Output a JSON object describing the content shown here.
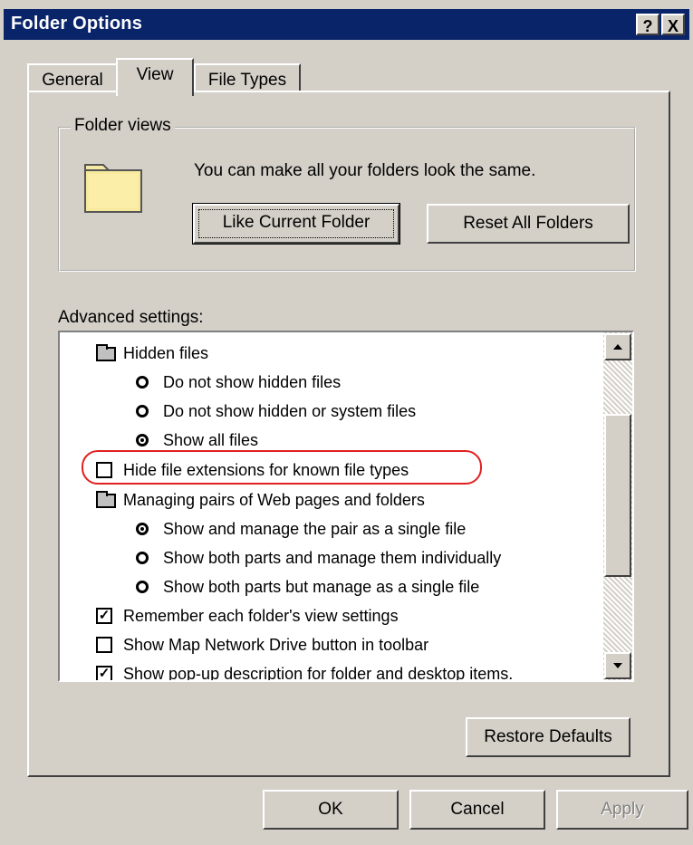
{
  "window": {
    "title": "Folder Options",
    "help_btn": "?",
    "close_btn": "X"
  },
  "tabs": [
    "General",
    "View",
    "File Types"
  ],
  "folder_views": {
    "legend": "Folder views",
    "text": "You can make all your folders look the same.",
    "like_current": "Like Current Folder",
    "reset_all": "Reset All Folders"
  },
  "advanced": {
    "label": "Advanced settings:",
    "items": [
      {
        "type": "folder",
        "label": "Hidden files"
      },
      {
        "type": "radio",
        "checked": false,
        "label": "Do not show hidden files"
      },
      {
        "type": "radio",
        "checked": false,
        "label": "Do not show hidden or system files"
      },
      {
        "type": "radio",
        "checked": true,
        "label": "Show all files"
      },
      {
        "type": "checkbox",
        "checked": false,
        "label": "Hide file extensions for known file types"
      },
      {
        "type": "folder",
        "label": "Managing pairs of Web pages and folders"
      },
      {
        "type": "radio",
        "checked": true,
        "label": "Show and manage the pair as a single file"
      },
      {
        "type": "radio",
        "checked": false,
        "label": "Show both parts and manage them individually"
      },
      {
        "type": "radio",
        "checked": false,
        "label": "Show both parts but manage as a single file"
      },
      {
        "type": "checkbox",
        "checked": true,
        "label": "Remember each folder's view settings"
      },
      {
        "type": "checkbox",
        "checked": false,
        "label": "Show Map Network Drive button in toolbar"
      },
      {
        "type": "checkbox",
        "checked": true,
        "label": "Show pop-up description for folder and desktop items."
      }
    ]
  },
  "buttons": {
    "restore": "Restore Defaults",
    "ok": "OK",
    "cancel": "Cancel",
    "apply": "Apply"
  },
  "colors": {
    "title_bg": "#0a246a",
    "face": "#d4d0c8",
    "highlight_ring": "#e02020"
  }
}
